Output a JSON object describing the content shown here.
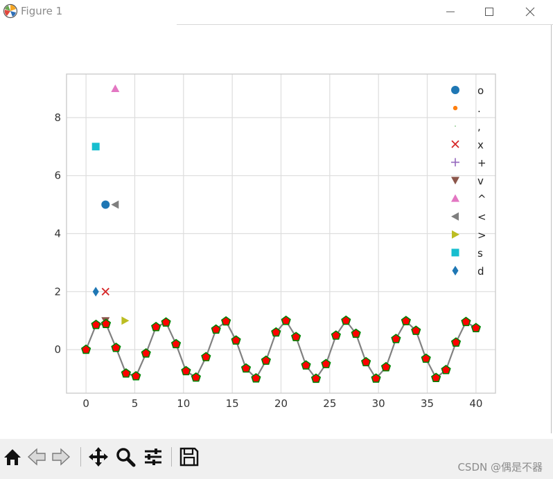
{
  "window": {
    "title": "Figure 1",
    "icon": "matplotlib-logo-icon",
    "controls": [
      "minimize-icon",
      "maximize-icon",
      "close-icon"
    ]
  },
  "toolbar": {
    "buttons": [
      "home-icon",
      "back-icon",
      "forward-icon",
      "pan-icon",
      "zoom-icon",
      "subplots-icon",
      "save-icon"
    ]
  },
  "watermark": "CSDN @偶是不器",
  "chart_data": {
    "type": "scatter",
    "title": "",
    "xlabel": "",
    "ylabel": "",
    "xlim": [
      -2,
      42
    ],
    "ylim": [
      -1.5,
      9.5
    ],
    "xticks": [
      0,
      5,
      10,
      15,
      20,
      25,
      30,
      35,
      40
    ],
    "yticks": [
      0,
      2,
      4,
      6,
      8
    ],
    "grid": true,
    "legend_position": "top-right",
    "sine_line": {
      "function": "sin(x)",
      "x_range": [
        0,
        40
      ],
      "num_points": 40,
      "line_color": "#808080",
      "marker": "pentagon",
      "marker_face": "#ff0000",
      "marker_edge": "#008000"
    },
    "series": [
      {
        "name": "o",
        "marker": "circle",
        "color": "#1f77b4",
        "points": [
          [
            2,
            5
          ]
        ]
      },
      {
        "name": ".",
        "marker": "point",
        "color": "#ff7f0e",
        "points": []
      },
      {
        "name": ",",
        "marker": "pixel",
        "color": "#2ca02c",
        "points": []
      },
      {
        "name": "x",
        "marker": "x",
        "color": "#d62728",
        "points": [
          [
            2,
            2
          ]
        ]
      },
      {
        "name": "+",
        "marker": "plus",
        "color": "#9467bd",
        "points": []
      },
      {
        "name": "v",
        "marker": "triangle-down",
        "color": "#8c564b",
        "points": [
          [
            2,
            1
          ]
        ]
      },
      {
        "name": "^",
        "marker": "triangle-up",
        "color": "#e377c2",
        "points": [
          [
            3,
            9
          ]
        ]
      },
      {
        "name": "<",
        "marker": "triangle-left",
        "color": "#7f7f7f",
        "points": [
          [
            3,
            5
          ]
        ]
      },
      {
        "name": ">",
        "marker": "triangle-right",
        "color": "#bcbd22",
        "points": [
          [
            4,
            1
          ]
        ]
      },
      {
        "name": "s",
        "marker": "square",
        "color": "#17becf",
        "points": [
          [
            1,
            7
          ]
        ]
      },
      {
        "name": "d",
        "marker": "diamond",
        "color": "#1f77b4",
        "points": [
          [
            1,
            2
          ]
        ]
      }
    ]
  }
}
